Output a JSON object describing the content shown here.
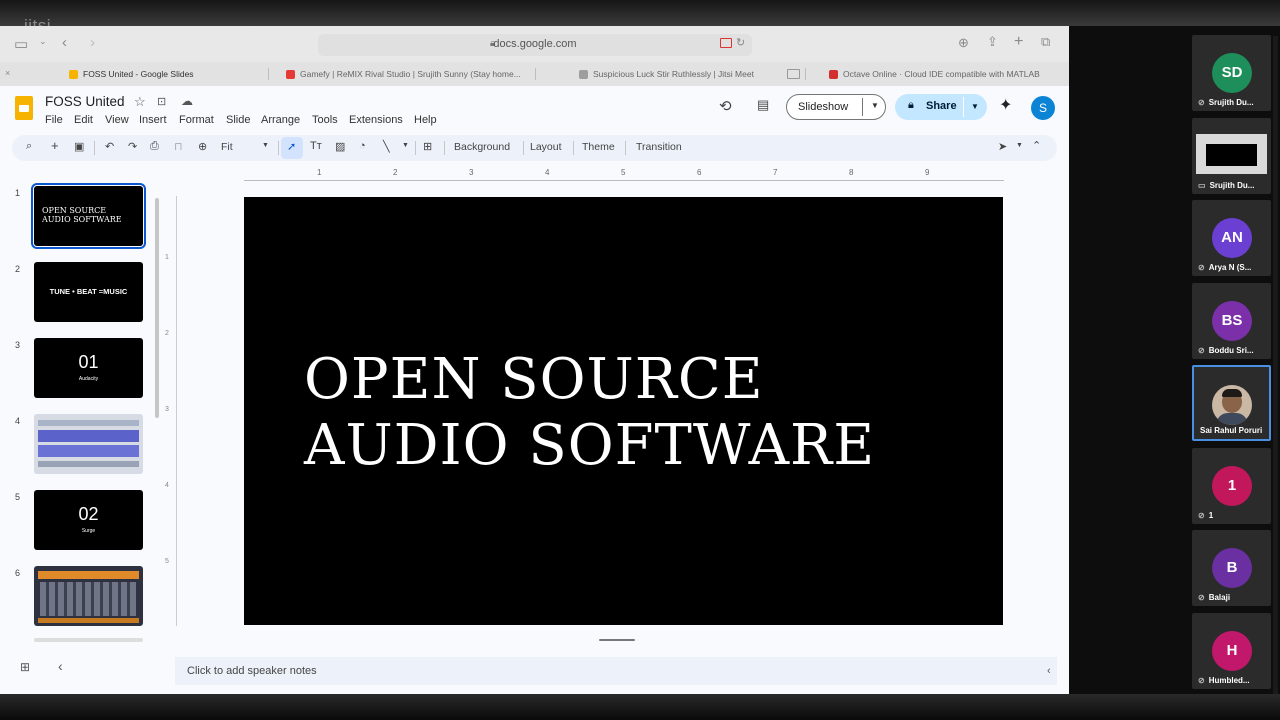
{
  "overlay": {
    "watermark": "jitsi"
  },
  "browser": {
    "url": "docs.google.com",
    "tabs": [
      {
        "label": "FOSS United - Google Slides",
        "color": "#f6b400"
      },
      {
        "label": "Gamefy | ReMIX Rival Studio | Srujith Sunny (Stay home...",
        "color": "#e53935"
      },
      {
        "label": "Suspicious Luck Stir Ruthlessly | Jitsi Meet",
        "color": "#9e9e9e"
      },
      {
        "label": "Octave Online · Cloud IDE compatible with MATLAB",
        "color": "#d32f2f"
      }
    ]
  },
  "slides_app": {
    "title": "FOSS United",
    "menu": [
      "File",
      "Edit",
      "View",
      "Insert",
      "Format",
      "Slide",
      "Arrange",
      "Tools",
      "Extensions",
      "Help"
    ],
    "slideshow_label": "Slideshow",
    "share_label": "Share",
    "avatar_letter": "S",
    "toolbar": {
      "zoom": "Fit",
      "background": "Background",
      "layout": "Layout",
      "theme": "Theme",
      "transition": "Transition"
    },
    "ruler_numbers": [
      "1",
      "2",
      "3",
      "4",
      "5",
      "6",
      "7",
      "8",
      "9"
    ],
    "vruler_numbers": [
      "1",
      "2",
      "3",
      "4",
      "5"
    ],
    "thumbnails": [
      {
        "num": "1",
        "text_line1": "OPEN SOURCE",
        "text_line2": "AUDIO SOFTWARE"
      },
      {
        "num": "2",
        "text": "TUNE • BEAT =MUSIC"
      },
      {
        "num": "3",
        "big": "01",
        "small": "Audacity"
      },
      {
        "num": "4"
      },
      {
        "num": "5",
        "big": "02",
        "small": "Surge"
      },
      {
        "num": "6"
      }
    ],
    "slide": {
      "line1": "OPEN SOURCE",
      "line2": "AUDIO SOFTWARE"
    },
    "notes_placeholder": "Click to add speaker notes"
  },
  "participants": [
    {
      "initials": "SD",
      "name": "Srujith Du...",
      "color": "#1e8e5a"
    },
    {
      "initials": "",
      "name": "Srujith Du...",
      "color": "#000000"
    },
    {
      "initials": "AN",
      "name": "Arya N (S...",
      "color": "#6a3fd1"
    },
    {
      "initials": "BS",
      "name": "Boddu Sri...",
      "color": "#7b2fa8"
    },
    {
      "initials": "",
      "name": "Sai Rahul Poruri",
      "color": "#5a6b7a"
    },
    {
      "initials": "1",
      "name": "1",
      "color": "#c2185b"
    },
    {
      "initials": "B",
      "name": "Balaji",
      "color": "#6a2fa0"
    },
    {
      "initials": "H",
      "name": "Humbled...",
      "color": "#c2186b"
    }
  ]
}
